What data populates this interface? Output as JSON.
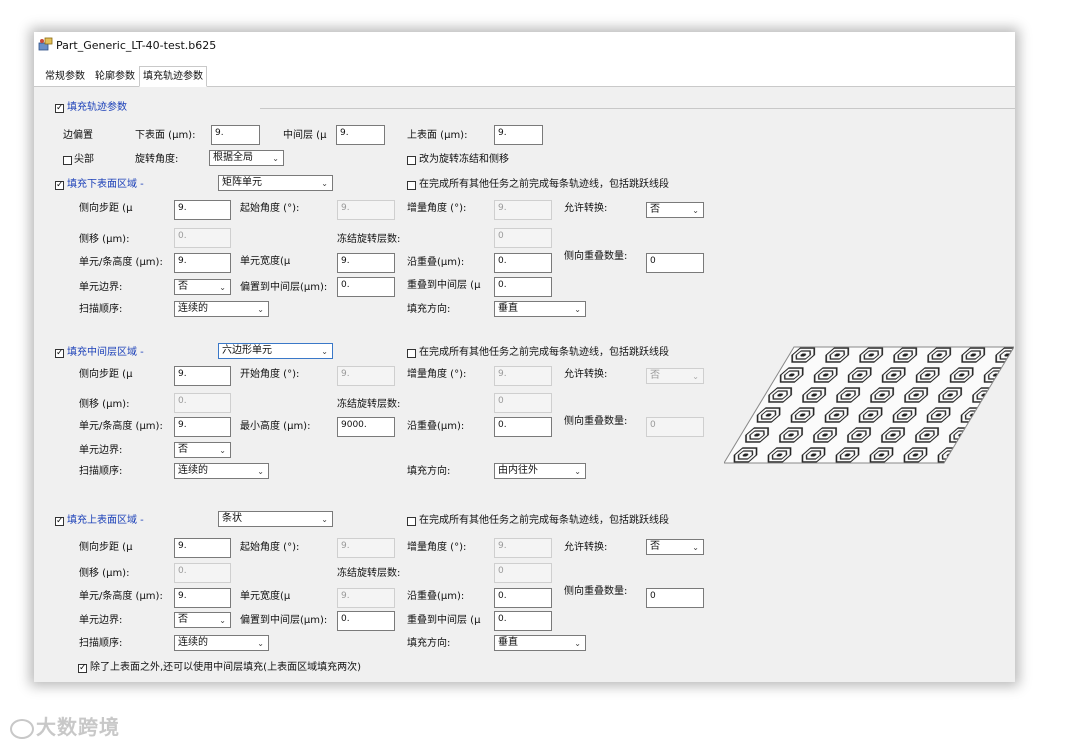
{
  "window": {
    "title": "Part_Generic_LT-40-test.b625",
    "icon": "app-icon"
  },
  "tabs": [
    {
      "label": "常规参数",
      "active": false
    },
    {
      "label": "轮廓参数",
      "active": false
    },
    {
      "label": "填充轨迹参数",
      "active": true
    }
  ],
  "fill_params": {
    "checkbox_label": "填充轨迹参数",
    "checked": true,
    "edge_offset_label": "边偏置",
    "lower_surface_label": "下表面 (μm):",
    "lower_surface_value": "9.",
    "mid_layer_label": "中间层 (μ",
    "mid_layer_value": "9.",
    "upper_surface_label": "上表面 (μm):",
    "upper_surface_value": "9.",
    "tip_label": "尖部",
    "tip_checked": false,
    "rotation_angle_label": "旋转角度:",
    "rotation_angle_value": "根据全局",
    "rotate_freeze_label": "改为旋转冻结和侧移",
    "rotate_freeze_checked": false
  },
  "lower_region": {
    "header": "填充下表面区域 -",
    "checked": true,
    "pattern": "矩阵单元",
    "complete_label": "在完成所有其他任务之前完成每条轨迹线，包括跳跃线段",
    "complete_checked": false,
    "hatch_spacing_label": "侧向步距 (μ",
    "hatch_spacing_value": "9.",
    "start_angle_label": "起始角度 (°):",
    "start_angle_value": "9.",
    "increment_angle_label": "增量角度 (°):",
    "increment_angle_value": "9.",
    "allow_switch_label": "允许转换:",
    "allow_switch_value": "否",
    "side_shift_label": "侧移 (μm):",
    "side_shift_value": "0.",
    "freeze_layers_label": "冻结旋转层数:",
    "freeze_layers_value": "0",
    "cell_height_label": "单元/条高度 (μm):",
    "cell_height_value": "9.",
    "cell_width_label": "单元宽度(μ",
    "cell_width_value": "9.",
    "overlap_label": "沿重叠(μm):",
    "overlap_value": "0.",
    "side_overlap_label": "侧向重叠数量:",
    "side_overlap_value": "0",
    "cell_border_label": "单元边界:",
    "cell_border_value": "否",
    "offset_mid_label": "偏置到中间层(μm):",
    "offset_mid_value": "0.",
    "overlap_mid_label": "重叠到中间层 (μ",
    "overlap_mid_value": "0.",
    "scan_order_label": "扫描顺序:",
    "scan_order_value": "连续的",
    "fill_dir_label": "填充方向:",
    "fill_dir_value": "垂直"
  },
  "mid_region": {
    "header": "填充中间层区域 -",
    "checked": true,
    "pattern": "六边形单元",
    "complete_label": "在完成所有其他任务之前完成每条轨迹线，包括跳跃线段",
    "complete_checked": false,
    "hatch_spacing_label": "侧向步距 (μ",
    "hatch_spacing_value": "9.",
    "start_angle_label": "开始角度 (°):",
    "start_angle_value": "9.",
    "increment_angle_label": "增量角度 (°):",
    "increment_angle_value": "9.",
    "allow_switch_label": "允许转换:",
    "allow_switch_value": "否",
    "side_shift_label": "侧移 (μm):",
    "side_shift_value": "0.",
    "freeze_layers_label": "冻结旋转层数:",
    "freeze_layers_value": "0",
    "cell_height_label": "单元/条高度 (μm):",
    "cell_height_value": "9.",
    "min_height_label": "最小高度 (μm):",
    "min_height_value": "9000.",
    "overlap_label": "沿重叠(μm):",
    "overlap_value": "0.",
    "side_overlap_label": "侧向重叠数量:",
    "side_overlap_value": "0",
    "cell_border_label": "单元边界:",
    "cell_border_value": "否",
    "scan_order_label": "扫描顺序:",
    "scan_order_value": "连续的",
    "fill_dir_label": "填充方向:",
    "fill_dir_value": "由内往外"
  },
  "upper_region": {
    "header": "填充上表面区域 -",
    "checked": true,
    "pattern": "条状",
    "complete_label": "在完成所有其他任务之前完成每条轨迹线，包括跳跃线段",
    "complete_checked": false,
    "hatch_spacing_label": "侧向步距 (μ",
    "hatch_spacing_value": "9.",
    "start_angle_label": "起始角度 (°):",
    "start_angle_value": "9.",
    "increment_angle_label": "增量角度 (°):",
    "increment_angle_value": "9.",
    "allow_switch_label": "允许转换:",
    "allow_switch_value": "否",
    "side_shift_label": "侧移 (μm):",
    "side_shift_value": "0.",
    "freeze_layers_label": "冻结旋转层数:",
    "freeze_layers_value": "0",
    "cell_height_label": "单元/条高度 (μm):",
    "cell_height_value": "9.",
    "cell_width_label": "单元宽度(μ",
    "cell_width_value": "9.",
    "overlap_label": "沿重叠(μm):",
    "overlap_value": "0.",
    "side_overlap_label": "侧向重叠数量:",
    "side_overlap_value": "0",
    "cell_border_label": "单元边界:",
    "cell_border_value": "否",
    "offset_mid_label": "偏置到中间层(μm):",
    "offset_mid_value": "0.",
    "overlap_mid_label": "重叠到中间层 (μ",
    "overlap_mid_value": "0.",
    "scan_order_label": "扫描顺序:",
    "scan_order_value": "连续的",
    "fill_dir_label": "填充方向:",
    "fill_dir_value": "垂直",
    "extra_label": "除了上表面之外,还可以使用中间层填充(上表面区域填充两次)",
    "extra_checked": true
  },
  "watermark": {
    "text": "大数跨境"
  },
  "preview": {
    "icon": "hexagon-fill-preview"
  }
}
